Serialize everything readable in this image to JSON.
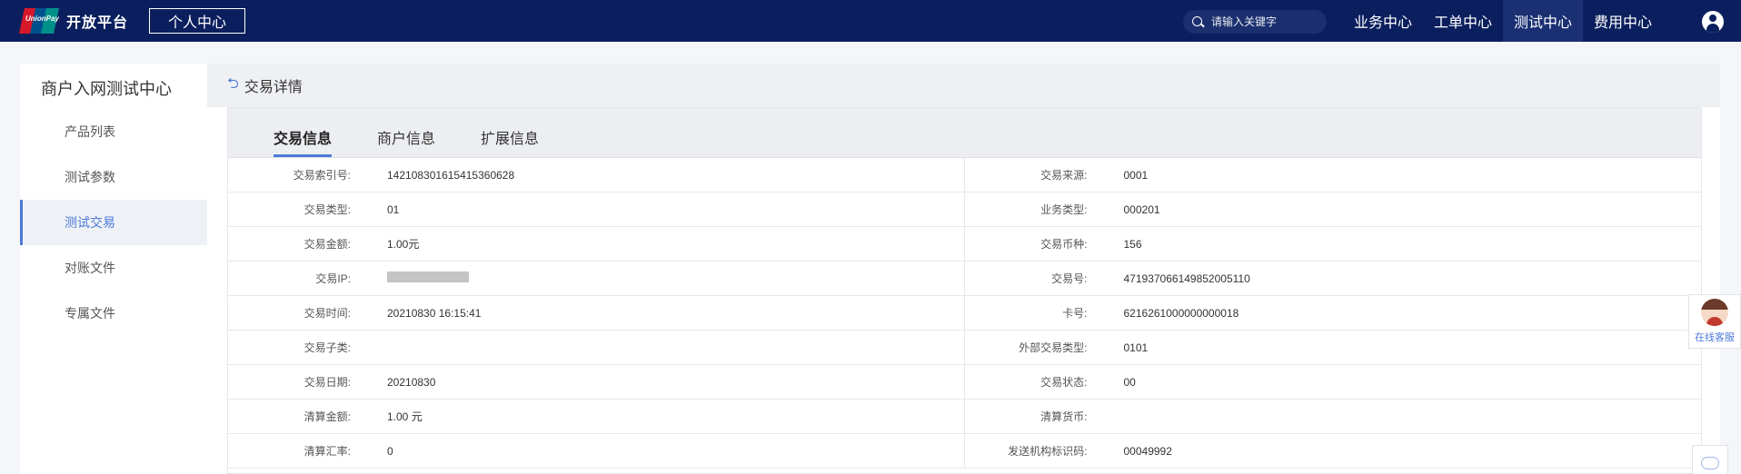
{
  "topbar": {
    "logo_text": "UnionPay",
    "brand": "开放平台",
    "personal_center": "个人中心",
    "search_placeholder": "请输入关键字",
    "nav": [
      "业务中心",
      "工单中心",
      "测试中心",
      "费用中心"
    ],
    "active_nav": "测试中心"
  },
  "sidebar": {
    "title": "商户入网测试中心",
    "items": [
      "产品列表",
      "测试参数",
      "测试交易",
      "对账文件",
      "专属文件"
    ],
    "active": "测试交易"
  },
  "main": {
    "title": "交易详情",
    "tabs": [
      "交易信息",
      "商户信息",
      "扩展信息"
    ],
    "active_tab": "交易信息",
    "rows": [
      {
        "l_label": "交易索引号:",
        "l_value": "142108301615415360628",
        "r_label": "交易来源:",
        "r_value": "0001"
      },
      {
        "l_label": "交易类型:",
        "l_value": "01",
        "r_label": "业务类型:",
        "r_value": "000201"
      },
      {
        "l_label": "交易金额:",
        "l_value": "1.00元",
        "r_label": "交易币种:",
        "r_value": "156"
      },
      {
        "l_label": "交易IP:",
        "l_value": "",
        "r_label": "交易号:",
        "r_value": "471937066149852005110"
      },
      {
        "l_label": "交易时间:",
        "l_value": "20210830 16:15:41",
        "r_label": "卡号:",
        "r_value": "6216261000000000018"
      },
      {
        "l_label": "交易子类:",
        "l_value": "",
        "r_label": "外部交易类型:",
        "r_value": "0101"
      },
      {
        "l_label": "交易日期:",
        "l_value": "20210830",
        "r_label": "交易状态:",
        "r_value": "00"
      },
      {
        "l_label": "清算金额:",
        "l_value": "1.00 元",
        "r_label": "清算货币:",
        "r_value": ""
      },
      {
        "l_label": "清算汇率:",
        "l_value": "0",
        "r_label": "发送机构标识码:",
        "r_value": "00049992"
      }
    ]
  },
  "float": {
    "label": "在线客服"
  },
  "colors": {
    "topbar": "#0b1f5e",
    "accent": "#4d7bd8"
  }
}
